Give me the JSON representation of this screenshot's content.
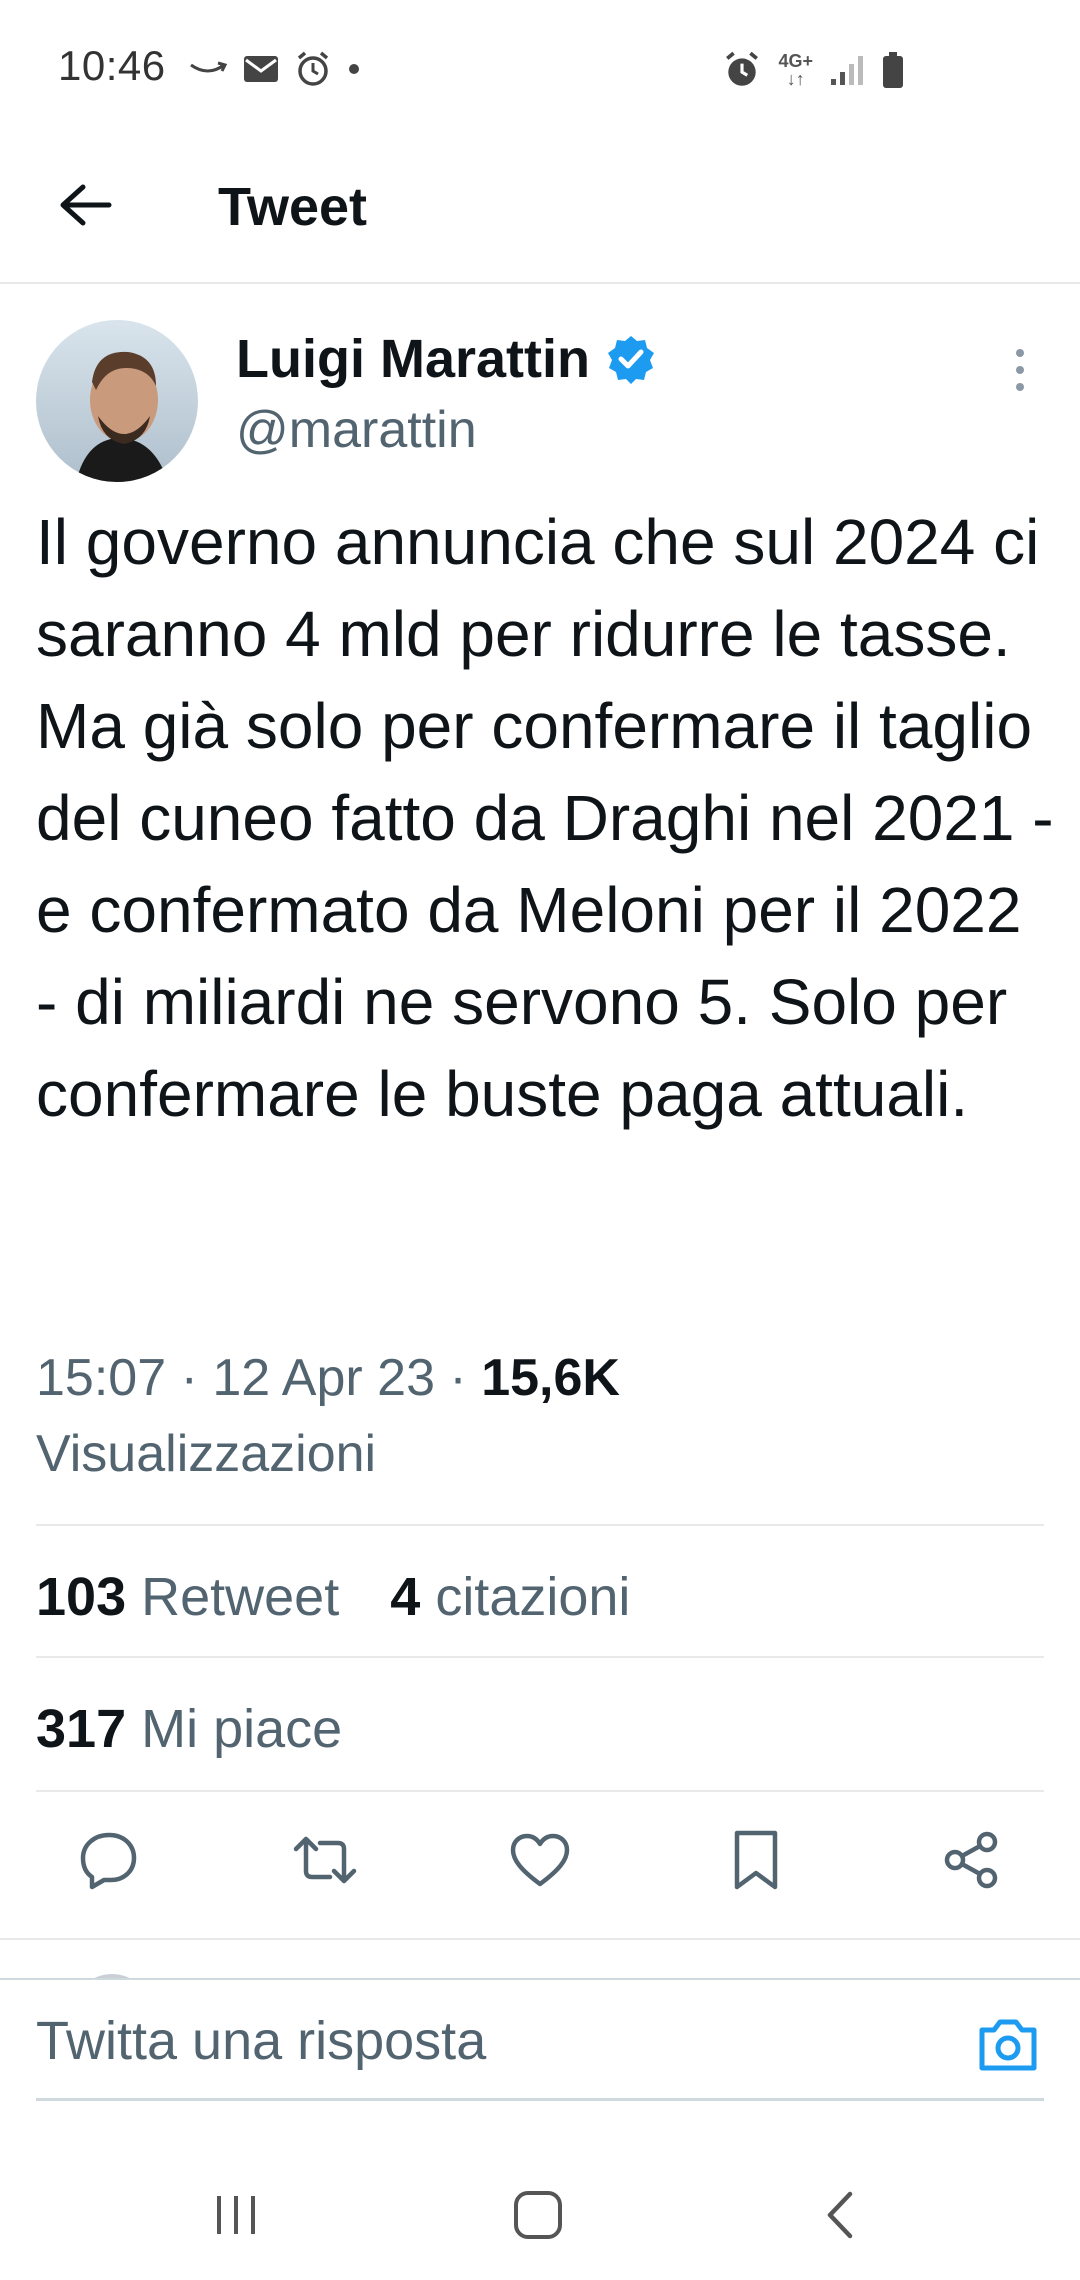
{
  "status_bar": {
    "time": "10:46",
    "network": "4G+",
    "icons_left": [
      "amazon-icon",
      "mail-icon",
      "alarm-icon",
      "dot-icon"
    ],
    "icons_right": [
      "alarm-icon",
      "network-4g-icon",
      "signal-icon",
      "battery-icon"
    ]
  },
  "header": {
    "title": "Tweet"
  },
  "tweet": {
    "author_name": "Luigi Marattin",
    "author_handle": "@marattin",
    "verified": true,
    "text": "Il governo annuncia che sul 2024 ci saranno 4 mld per ridurre le tasse. Ma già solo per confermare il taglio del cuneo fatto da Draghi nel 2021 - e confermato da Meloni per il 2022 - di miliardi ne servono 5. Solo per confermare le buste paga attuali.",
    "time": "15:07",
    "date": "12 Apr 23",
    "views_count": "15,6K",
    "views_label": "Visualizzazioni",
    "separator": " · "
  },
  "stats": {
    "retweets_count": "103",
    "retweets_label": "Retweet",
    "quotes_count": "4",
    "quotes_label": "citazioni",
    "likes_count": "317",
    "likes_label": "Mi piace"
  },
  "actions": [
    "reply-icon",
    "retweet-icon",
    "like-icon",
    "bookmark-icon",
    "share-icon"
  ],
  "compose": {
    "placeholder": "Twitta una risposta"
  },
  "colors": {
    "accent": "#1d9bf0",
    "text_primary": "#0f1419",
    "text_secondary": "#536471",
    "divider": "#e7e9ea"
  }
}
